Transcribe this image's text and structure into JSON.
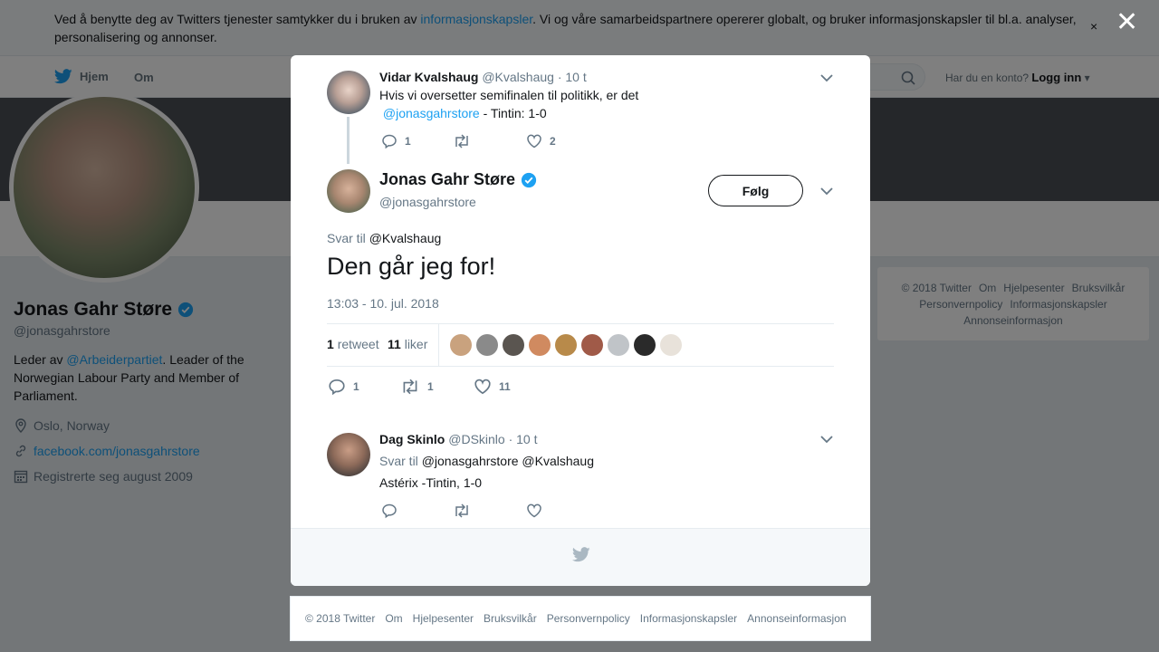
{
  "cookie": {
    "text_before": "Ved å benytte deg av Twitters tjenester samtykker du i bruken av ",
    "link": "informasjonskapsler",
    "text_after": ". Vi og våre samarbeidspartnere opererer globalt, og bruker informasjonskapsler til bl.a. analyser, personalisering og annonser.",
    "close": "×"
  },
  "nav": {
    "home": "Hjem",
    "about": "Om",
    "account_prompt": "Har du en konto?",
    "login": "Logg inn"
  },
  "profile": {
    "name": "Jonas Gahr Støre",
    "handle": "@jonasgahrstore",
    "bio_before": "Leder av ",
    "bio_mention": "@Arbeiderpartiet",
    "bio_after": ". Leader of the Norwegian Labour Party and Member of Parliament.",
    "location": "Oslo, Norway",
    "website": "facebook.com/jonasgahrstore",
    "joined": "Registrerte seg august 2009"
  },
  "right_footer": [
    "© 2018 Twitter",
    "Om",
    "Hjelpesenter",
    "Bruksvilkår",
    "Personvernpolicy",
    "Informasjonskapsler",
    "Annonseinformasjon"
  ],
  "overlay_close": "✕",
  "parent_tweet": {
    "name": "Vidar Kvalshaug",
    "handle": "@Kvalshaug",
    "time": "· 10 t",
    "text_line1": "Hvis vi oversetter semifinalen til politikk, er det",
    "mention": "@jonasgahrstore",
    "text_after": " - Tintin: 1-0",
    "replies": "1",
    "retweets": "",
    "likes": "2"
  },
  "main_tweet": {
    "name": "Jonas Gahr Støre",
    "handle": "@jonasgahrstore",
    "follow": "Følg",
    "reply_prefix": "Svar til",
    "reply_user": "@Kvalshaug",
    "text": "Den går jeg for!",
    "timestamp": "13:03 - 10. jul. 2018",
    "retweet_count": "1",
    "retweet_label": "retweet",
    "like_count": "11",
    "like_label": "liker",
    "liker_colors": [
      "#c9a27e",
      "#8a8a8a",
      "#5a5550",
      "#d08a60",
      "#b88a4a",
      "#a05a48",
      "#c0c4c8",
      "#2a2a2a",
      "#e8e2da"
    ],
    "replies": "1",
    "retweets": "1",
    "likes": "11"
  },
  "reply_tweet": {
    "name": "Dag Skinlo",
    "handle": "@DSkinlo",
    "time": "· 10 t",
    "reply_prefix": "Svar til",
    "reply_users": "@jonasgahrstore @Kvalshaug",
    "text": "Astérix -Tintin, 1-0"
  },
  "bottom_footer": [
    "© 2018 Twitter",
    "Om",
    "Hjelpesenter",
    "Bruksvilkår",
    "Personvernpolicy",
    "Informasjonskapsler",
    "Annonseinformasjon"
  ],
  "colors": {
    "accent": "#1da1f2",
    "verified": "#1da1f2",
    "like_red": "#e0245e"
  }
}
